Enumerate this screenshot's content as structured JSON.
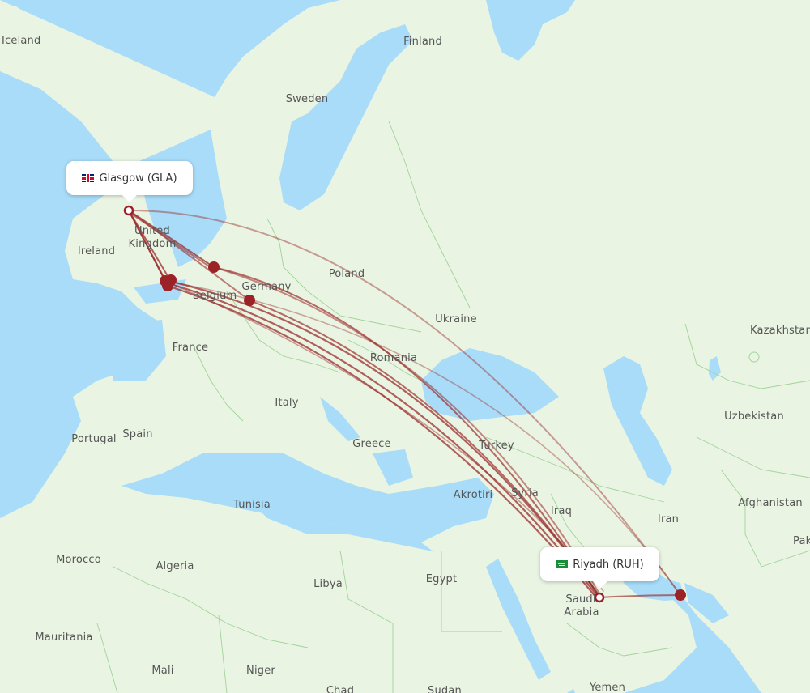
{
  "map": {
    "colors": {
      "water": "#a8dcf8",
      "land": "#eaf4e2",
      "border": "#9fd49a",
      "route": "#9b2c2c",
      "airport_dot": "#9b2226"
    },
    "origin": {
      "name": "Glasgow (GLA)",
      "flag": "uk-flag-icon"
    },
    "destination": {
      "name": "Riyadh (RUH)",
      "flag": "saudi-flag-icon"
    },
    "country_labels": [
      "Iceland",
      "Finland",
      "Sweden",
      "United",
      "Kingdom",
      "Ireland",
      "Poland",
      "Germany",
      "Belgium",
      "France",
      "Ukraine",
      "Kazakhstan",
      "Romania",
      "Italy",
      "Uzbekistan",
      "Portugal",
      "Spain",
      "Greece",
      "Turkey",
      "Syria",
      "Akrotiri",
      "Iraq",
      "Iran",
      "Afghanistan",
      "Pak",
      "Tunisia",
      "Morocco",
      "Algeria",
      "Libya",
      "Egypt",
      "Saudi",
      "Arabia",
      "Mauritania",
      "Mali",
      "Niger",
      "Chad",
      "Sudan",
      "Yemen"
    ]
  }
}
